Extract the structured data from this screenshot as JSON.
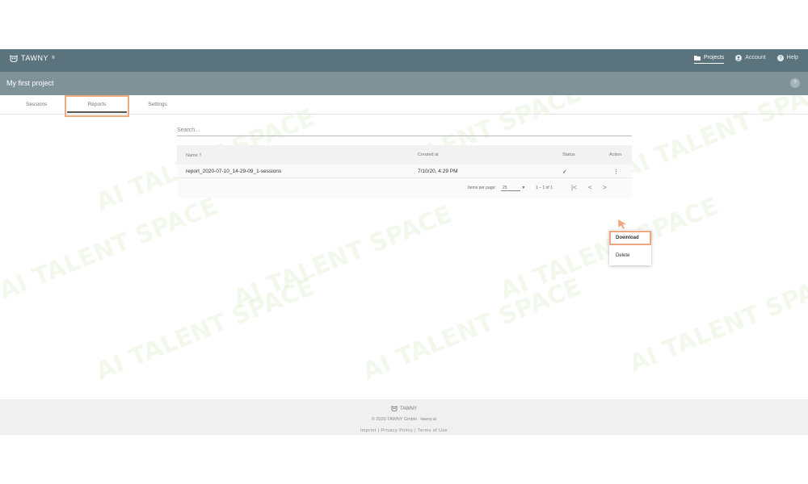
{
  "header": {
    "logo_text": "TAWNY",
    "logo_mark": "®",
    "nav": [
      {
        "label": "Projects",
        "icon": "folder-icon",
        "active": true
      },
      {
        "label": "Account",
        "icon": "account-circle-icon",
        "active": false
      },
      {
        "label": "Help",
        "icon": "help-circle-icon",
        "active": false
      }
    ]
  },
  "project": {
    "title": "My first project",
    "badge": "?"
  },
  "tabs": [
    {
      "label": "Sessions"
    },
    {
      "label": "Reports",
      "selected": true
    },
    {
      "label": "Settings"
    }
  ],
  "search": {
    "placeholder": "Search..."
  },
  "table": {
    "columns": {
      "name": "Name",
      "sort": "↑",
      "created": "Created at",
      "status": "Status",
      "action": "Action"
    },
    "rows": [
      {
        "name": "report_2020-07-10_14-29-09_1-sessions",
        "created": "7/10/20, 4:29 PM",
        "status": "✓",
        "action": "⋮"
      }
    ]
  },
  "pager": {
    "items_label": "Items per page:",
    "items_value": "25",
    "range": "1 – 1 of 1",
    "first": "|<",
    "prev": "<",
    "next": ">"
  },
  "action_menu": {
    "download": "Download",
    "delete": "Delete"
  },
  "footer": {
    "logo_text": "TAWNY",
    "copyright": "© 2020 TAWNY GmbH",
    "site": "tawny.ai",
    "links": [
      "Imprint",
      "Privacy Policy",
      "Terms of Use"
    ],
    "separator": "|"
  },
  "watermark": "AI TALENT SPACE",
  "colors": {
    "topbar": "#5a737c",
    "project_bar": "#7f9298",
    "highlight": "#f0a880",
    "watermark": "#9ed66b"
  }
}
